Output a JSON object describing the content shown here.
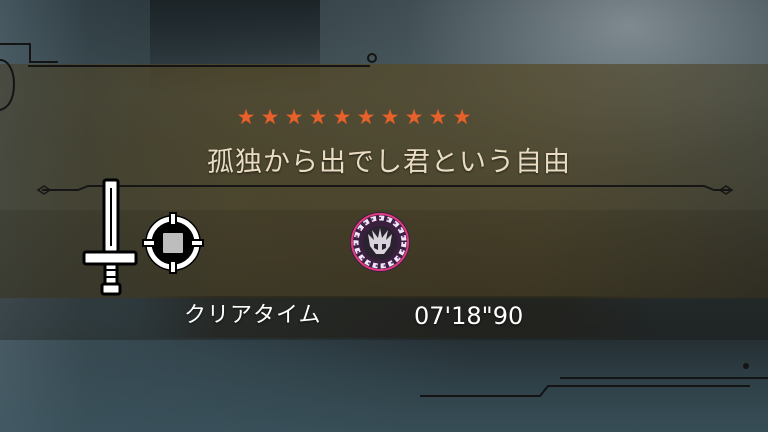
{
  "quest": {
    "star_count": 10,
    "star_glyph": "★",
    "star_color": "#e8612b",
    "title": "孤独から出でし君という自由"
  },
  "icons": {
    "weapon": "long-sword-icon",
    "target": "target-crosshair-icon",
    "monster": "monster-emblem-icon"
  },
  "result": {
    "clear_label": "クリアタイム",
    "clear_time": "07'18\"90"
  },
  "colors": {
    "panel": "#55482a",
    "title_text": "#e9dcc2",
    "line": "#1a1a1a"
  }
}
